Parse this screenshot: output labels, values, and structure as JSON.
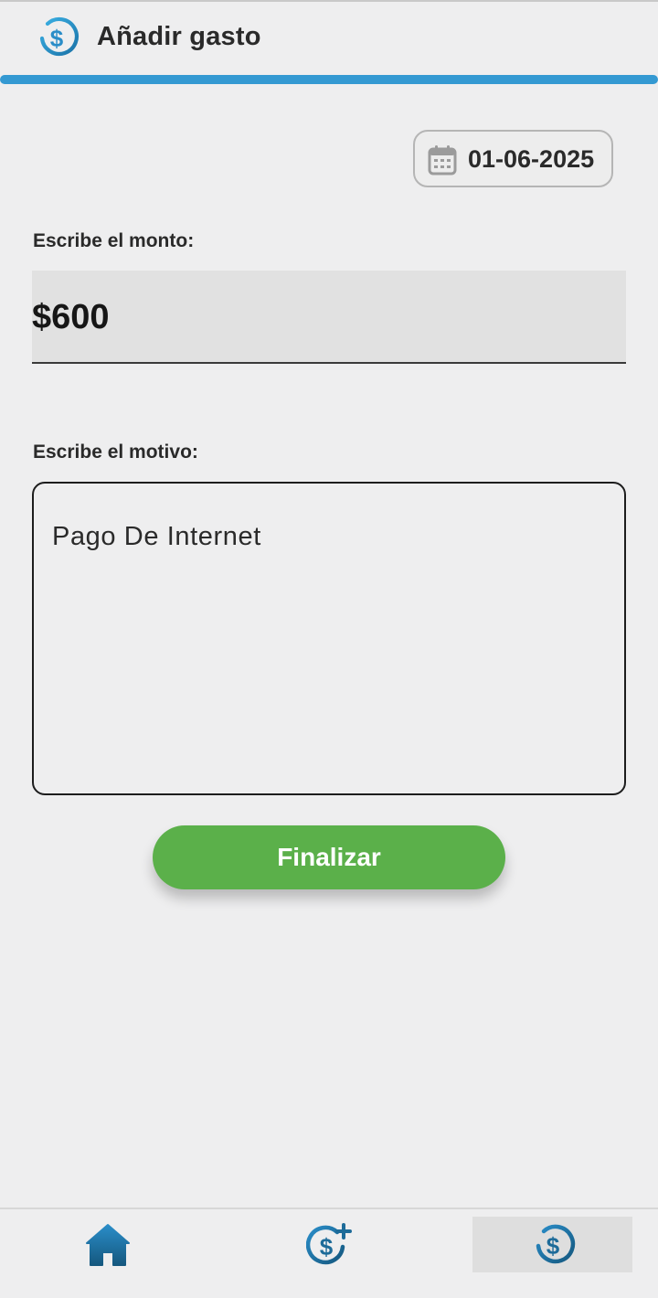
{
  "header": {
    "title": "Añadir gasto",
    "icon": "expense-dollar-icon",
    "accent_color": "#3499d2"
  },
  "date": {
    "icon": "calendar-icon",
    "value": "01-06-2025"
  },
  "amount": {
    "label": "Escribe el monto:",
    "value": "$600"
  },
  "reason": {
    "label": "Escribe el motivo:",
    "value": "Pago De Internet"
  },
  "submit": {
    "label": "Finalizar",
    "color": "#5bb04a"
  },
  "bottom_nav": {
    "items": [
      {
        "icon": "home-icon",
        "selected": false
      },
      {
        "icon": "add-income-icon",
        "selected": false
      },
      {
        "icon": "add-expense-icon",
        "selected": true
      }
    ],
    "icon_color": "#1d6b99"
  }
}
